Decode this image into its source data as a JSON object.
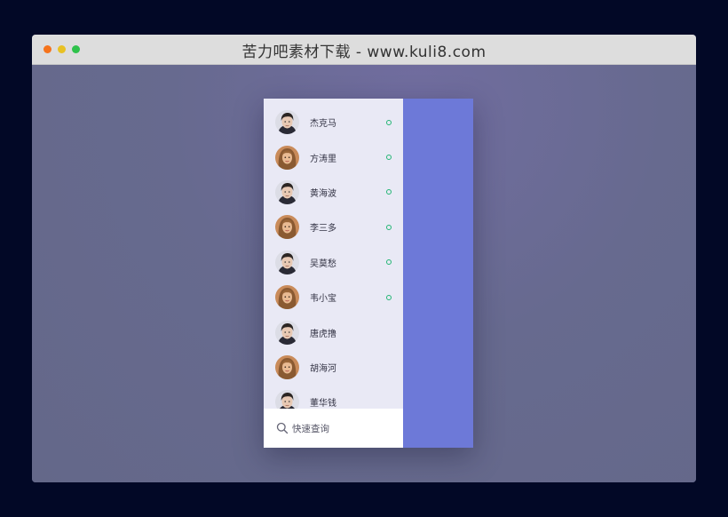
{
  "window": {
    "title": "苦力吧素材下载 - www.kuli8.com"
  },
  "contacts": [
    {
      "name": "杰克马",
      "avatar": "male-avatar-icon",
      "online": true
    },
    {
      "name": "方涛里",
      "avatar": "female-avatar-icon",
      "online": true
    },
    {
      "name": "黄海波",
      "avatar": "male-avatar-icon",
      "online": true
    },
    {
      "name": "李三多",
      "avatar": "female-avatar-icon",
      "online": true
    },
    {
      "name": "吴莫愁",
      "avatar": "male-avatar-icon",
      "online": true
    },
    {
      "name": "韦小宝",
      "avatar": "female-avatar-icon",
      "online": true
    },
    {
      "name": "唐虎撸",
      "avatar": "male-avatar-icon",
      "online": false
    },
    {
      "name": "胡海河",
      "avatar": "female-avatar-icon",
      "online": false
    },
    {
      "name": "董华钱",
      "avatar": "male-avatar-icon",
      "online": false
    }
  ],
  "search": {
    "placeholder": "快速查询",
    "icon": "search-icon"
  },
  "colors": {
    "page_background": "#020826",
    "titlebar": "#dddddd",
    "content_background": "#676a8f",
    "list_background": "#e9e9f5",
    "side_panel": "#6d79d8",
    "online_indicator": "#22b573"
  }
}
